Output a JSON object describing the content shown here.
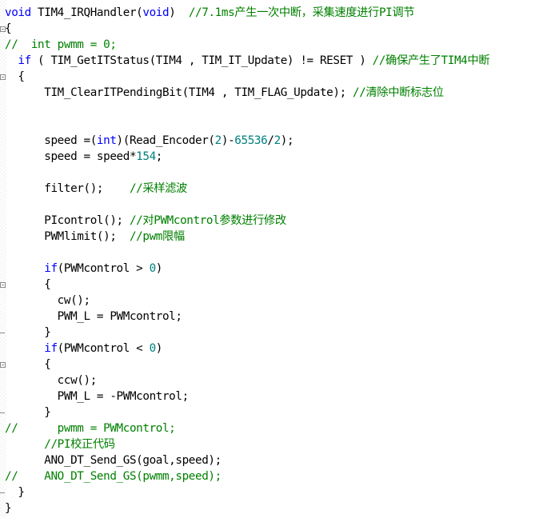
{
  "editor": {
    "language": "C",
    "lines": [
      {
        "segments": [
          {
            "t": "void",
            "c": "kw"
          },
          {
            "t": " TIM4_IRQHandler(",
            "c": ""
          },
          {
            "t": "void",
            "c": "kw"
          },
          {
            "t": ")  ",
            "c": ""
          },
          {
            "t": "//7.1ms产生一次中断，采集速度进行PI调节",
            "c": "cm"
          }
        ]
      },
      {
        "segments": [
          {
            "t": "{",
            "c": ""
          }
        ],
        "fold": "start"
      },
      {
        "segments": [
          {
            "t": "//  int pwmm = 0;",
            "c": "cm"
          }
        ]
      },
      {
        "segments": [
          {
            "t": "  ",
            "c": ""
          },
          {
            "t": "if",
            "c": "kw"
          },
          {
            "t": " ( TIM_GetITStatus(TIM4 , TIM_IT_Update) != RESET ) ",
            "c": ""
          },
          {
            "t": "//确保产生了TIM4中断",
            "c": "cm"
          }
        ]
      },
      {
        "segments": [
          {
            "t": "  {",
            "c": ""
          }
        ],
        "fold": "start"
      },
      {
        "segments": [
          {
            "t": "      TIM_ClearITPendingBit(TIM4 , TIM_FLAG_Update); ",
            "c": ""
          },
          {
            "t": "//清除中断标志位",
            "c": "cm"
          }
        ]
      },
      {
        "segments": []
      },
      {
        "segments": []
      },
      {
        "segments": [
          {
            "t": "      speed =(",
            "c": ""
          },
          {
            "t": "int",
            "c": "kw"
          },
          {
            "t": ")(Read_Encoder(",
            "c": ""
          },
          {
            "t": "2",
            "c": "num"
          },
          {
            "t": ")-",
            "c": ""
          },
          {
            "t": "65536",
            "c": "num"
          },
          {
            "t": "/",
            "c": ""
          },
          {
            "t": "2",
            "c": "num"
          },
          {
            "t": ");",
            "c": ""
          }
        ]
      },
      {
        "segments": [
          {
            "t": "      speed = speed*",
            "c": ""
          },
          {
            "t": "154",
            "c": "num"
          },
          {
            "t": ";",
            "c": ""
          }
        ]
      },
      {
        "segments": []
      },
      {
        "segments": [
          {
            "t": "      filter();    ",
            "c": ""
          },
          {
            "t": "//采样滤波",
            "c": "cm"
          }
        ]
      },
      {
        "segments": []
      },
      {
        "segments": [
          {
            "t": "      PIcontrol(); ",
            "c": ""
          },
          {
            "t": "//对PWMcontrol参数进行修改",
            "c": "cm"
          }
        ]
      },
      {
        "segments": [
          {
            "t": "      PWMlimit();  ",
            "c": ""
          },
          {
            "t": "//pwm限幅",
            "c": "cm"
          }
        ]
      },
      {
        "segments": []
      },
      {
        "segments": [
          {
            "t": "      ",
            "c": ""
          },
          {
            "t": "if",
            "c": "kw"
          },
          {
            "t": "(PWMcontrol > ",
            "c": ""
          },
          {
            "t": "0",
            "c": "num"
          },
          {
            "t": ")",
            "c": ""
          }
        ]
      },
      {
        "segments": [
          {
            "t": "      {",
            "c": ""
          }
        ],
        "fold": "start"
      },
      {
        "segments": [
          {
            "t": "        cw();",
            "c": ""
          }
        ]
      },
      {
        "segments": [
          {
            "t": "        PWM_L = PWMcontrol;",
            "c": ""
          }
        ]
      },
      {
        "segments": [
          {
            "t": "      }",
            "c": ""
          }
        ],
        "fold": "end"
      },
      {
        "segments": [
          {
            "t": "      ",
            "c": ""
          },
          {
            "t": "if",
            "c": "kw"
          },
          {
            "t": "(PWMcontrol < ",
            "c": ""
          },
          {
            "t": "0",
            "c": "num"
          },
          {
            "t": ")",
            "c": ""
          }
        ]
      },
      {
        "segments": [
          {
            "t": "      {",
            "c": ""
          }
        ],
        "fold": "start"
      },
      {
        "segments": [
          {
            "t": "        ccw();",
            "c": ""
          }
        ]
      },
      {
        "segments": [
          {
            "t": "        PWM_L = -PWMcontrol;",
            "c": ""
          }
        ]
      },
      {
        "segments": [
          {
            "t": "      }",
            "c": ""
          }
        ],
        "fold": "end"
      },
      {
        "segments": [
          {
            "t": "//      pwmm = PWMcontrol;",
            "c": "cm"
          }
        ]
      },
      {
        "segments": [
          {
            "t": "      ",
            "c": ""
          },
          {
            "t": "//PI校正代码",
            "c": "cm"
          }
        ]
      },
      {
        "segments": [
          {
            "t": "      ANO_DT_Send_GS(goal,speed);",
            "c": ""
          }
        ]
      },
      {
        "segments": [
          {
            "t": "//    ANO_DT_Send_GS(pwmm,speed);",
            "c": "cm"
          }
        ]
      },
      {
        "segments": [
          {
            "t": "  }",
            "c": ""
          }
        ],
        "fold": "end"
      },
      {
        "segments": [
          {
            "t": "}",
            "c": ""
          }
        ]
      }
    ]
  },
  "colors": {
    "keyword": "#0000ff",
    "number": "#008080",
    "comment": "#008000",
    "text": "#000000",
    "background": "#ffffff"
  }
}
